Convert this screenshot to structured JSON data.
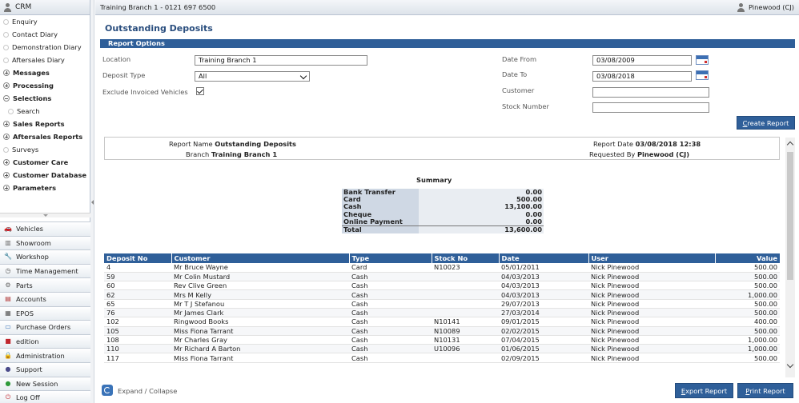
{
  "sidebar": {
    "header": "CRM",
    "menu": [
      {
        "label": "Enquiry",
        "kind": "leaf"
      },
      {
        "label": "Contact Diary",
        "kind": "leaf"
      },
      {
        "label": "Demonstration Diary",
        "kind": "leaf"
      },
      {
        "label": "Aftersales Diary",
        "kind": "leaf"
      },
      {
        "label": "Messages",
        "kind": "plus"
      },
      {
        "label": "Processing",
        "kind": "plus"
      },
      {
        "label": "Selections",
        "kind": "minus"
      },
      {
        "label": "Search",
        "kind": "sub"
      },
      {
        "label": "Sales Reports",
        "kind": "plus"
      },
      {
        "label": "Aftersales Reports",
        "kind": "plus"
      },
      {
        "label": "Surveys",
        "kind": "leaf"
      },
      {
        "label": "Customer Care",
        "kind": "plus"
      },
      {
        "label": "Customer Database",
        "kind": "plus"
      },
      {
        "label": "Parameters",
        "kind": "plus"
      }
    ],
    "modules": [
      {
        "label": "Vehicles",
        "icon": "car-icon",
        "glyph": "🚗",
        "color": "#3a73b8"
      },
      {
        "label": "Showroom",
        "icon": "showroom-icon",
        "glyph": "▥",
        "color": "#666666"
      },
      {
        "label": "Workshop",
        "icon": "wrench-icon",
        "glyph": "🔧",
        "color": "#777777"
      },
      {
        "label": "Time Management",
        "icon": "clock-icon",
        "glyph": "◷",
        "color": "#555555"
      },
      {
        "label": "Parts",
        "icon": "parts-icon",
        "glyph": "⚙",
        "color": "#666666"
      },
      {
        "label": "Accounts",
        "icon": "accounts-icon",
        "glyph": "▤",
        "color": "#b03030"
      },
      {
        "label": "EPOS",
        "icon": "epos-icon",
        "glyph": "▦",
        "color": "#555555"
      },
      {
        "label": "Purchase Orders",
        "icon": "purchase-orders-icon",
        "glyph": "▭",
        "color": "#3a73b8"
      },
      {
        "label": "edition",
        "icon": "edition-icon",
        "glyph": "■",
        "color": "#c0262d"
      },
      {
        "label": "Administration",
        "icon": "lock-icon",
        "glyph": "🔒",
        "color": "#d8a020"
      },
      {
        "label": "Support",
        "icon": "support-icon",
        "glyph": "●",
        "color": "#4a4a8a"
      },
      {
        "label": "New Session",
        "icon": "new-session-icon",
        "glyph": "●",
        "color": "#2e9a3a"
      },
      {
        "label": "Log Off",
        "icon": "power-icon",
        "glyph": "⏻",
        "color": "#c0262d"
      }
    ]
  },
  "topbar": {
    "branch": "Training Branch 1 - 0121 697 6500",
    "user": "Pinewood (CJ)"
  },
  "page": {
    "title": "Outstanding Deposits",
    "section": "Report Options"
  },
  "form": {
    "location_label": "Location",
    "location_value": "Training Branch 1",
    "deposit_type_label": "Deposit Type",
    "deposit_type_value": "All",
    "exclude_label": "Exclude Invoiced Vehicles",
    "date_from_label": "Date From",
    "date_from_value": "03/08/2009",
    "date_to_label": "Date To",
    "date_to_value": "03/08/2018",
    "customer_label": "Customer",
    "customer_value": "",
    "stock_label": "Stock Number",
    "stock_value": "",
    "create_report_hotkey": "C",
    "create_report_rest": "reate Report"
  },
  "report": {
    "report_name_label": "Report Name",
    "report_name": "Outstanding Deposits",
    "branch_label": "Branch",
    "branch": "Training Branch 1",
    "report_date_label": "Report Date",
    "report_date": "03/08/2018 12:38",
    "requested_by_label": "Requested By",
    "requested_by": "Pinewood (CJ)",
    "summary_title": "Summary",
    "summary": [
      {
        "label": "Bank Transfer",
        "value": "0.00"
      },
      {
        "label": "Card",
        "value": "500.00"
      },
      {
        "label": "Cash",
        "value": "13,100.00"
      },
      {
        "label": "Cheque",
        "value": "0.00"
      },
      {
        "label": "Online Payment",
        "value": "0.00"
      },
      {
        "label": "Total",
        "value": "13,600.00"
      }
    ],
    "columns": [
      "Deposit No",
      "Customer",
      "Type",
      "Stock No",
      "Date",
      "User",
      "Value"
    ],
    "rows": [
      [
        "4",
        "Mr Bruce Wayne",
        "Card",
        "N10023",
        "05/01/2011",
        "Nick Pinewood",
        "500.00"
      ],
      [
        "59",
        "Mr Colin Mustard",
        "Cash",
        "",
        "04/03/2013",
        "Nick Pinewood",
        "500.00"
      ],
      [
        "60",
        "Rev Clive Green",
        "Cash",
        "",
        "04/03/2013",
        "Nick Pinewood",
        "500.00"
      ],
      [
        "62",
        "Mrs M Kelly",
        "Cash",
        "",
        "04/03/2013",
        "Nick Pinewood",
        "1,000.00"
      ],
      [
        "65",
        "Mr T J Stefanou",
        "Cash",
        "",
        "29/07/2013",
        "Nick Pinewood",
        "500.00"
      ],
      [
        "76",
        "Mr James Clark",
        "Cash",
        "",
        "27/03/2014",
        "Nick Pinewood",
        "500.00"
      ],
      [
        "102",
        "Ringwood Books",
        "Cash",
        "N10141",
        "09/01/2015",
        "Nick Pinewood",
        "400.00"
      ],
      [
        "105",
        "Miss Fiona Tarrant",
        "Cash",
        "N10089",
        "02/02/2015",
        "Nick Pinewood",
        "500.00"
      ],
      [
        "108",
        "Mr Charles Gray",
        "Cash",
        "N10131",
        "07/04/2015",
        "Nick Pinewood",
        "1,000.00"
      ],
      [
        "110",
        "Mr Richard A Barton",
        "Cash",
        "U10096",
        "01/06/2015",
        "Nick Pinewood",
        "1,000.00"
      ],
      [
        "117",
        "Miss Fiona Tarrant",
        "Cash",
        "",
        "02/09/2015",
        "Nick Pinewood",
        "500.00"
      ]
    ]
  },
  "bottom": {
    "expand_label": "Expand / Collapse",
    "export_hotkey": "E",
    "export_rest": "xport Report",
    "print_hotkey": "P",
    "print_rest": "rint Report"
  }
}
